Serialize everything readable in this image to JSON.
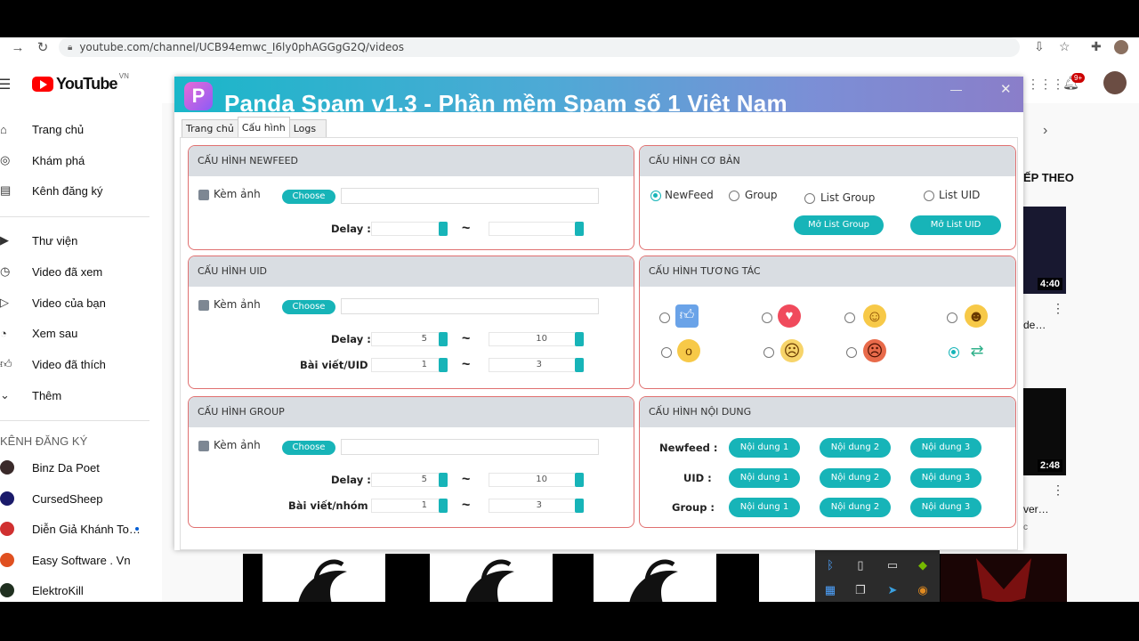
{
  "browser": {
    "url": "youtube.com/channel/UCB94emwc_I6ly0phAGGgG2Q/videos"
  },
  "youtube": {
    "logo_text": "YouTube",
    "region": "VN",
    "notif_badge": "9+",
    "sidebar": [
      {
        "icon": "home-icon",
        "label": "Trang chủ"
      },
      {
        "icon": "compass-icon",
        "label": "Khám phá"
      },
      {
        "icon": "subscriptions-icon",
        "label": "Kênh đăng ký"
      },
      {
        "icon": "library-icon",
        "label": "Thư viện"
      },
      {
        "icon": "history-icon",
        "label": "Video đã xem"
      },
      {
        "icon": "your-videos-icon",
        "label": "Video của bạn"
      },
      {
        "icon": "watch-later-icon",
        "label": "Xem sau"
      },
      {
        "icon": "like-icon",
        "label": "Video đã thích"
      },
      {
        "icon": "chevron-down-icon",
        "label": "Thêm"
      }
    ],
    "subs_heading": "KÊNH ĐĂNG KÝ",
    "subscriptions": [
      "Binz Da Poet",
      "CursedSheep",
      "Diễn Giả Khánh To…",
      "Easy Software . Vn",
      "ElektroKill"
    ],
    "right": {
      "heading": "ẾP THEO",
      "dur1": "4:40",
      "title1": "de…",
      "dur2": "2:48",
      "title2": "ver…",
      "meta2": "c"
    }
  },
  "app": {
    "title": "Panda Spam v1.3 - Phần mềm Spam số 1 Việt Nam",
    "tabs": [
      "Trang chủ",
      "Cấu hình",
      "Logs"
    ],
    "newfeed": {
      "heading": "CẤU HÌNH NEWFEED",
      "attach": "Kèm ảnh",
      "choose": "Choose",
      "delay": "Delay :",
      "tilde": "~"
    },
    "uid": {
      "heading": "CẤU HÌNH UID",
      "attach": "Kèm ảnh",
      "choose": "Choose",
      "delay": "Delay :",
      "delay_from": "5",
      "delay_to": "10",
      "posts": "Bài viết/UID :",
      "posts_from": "1",
      "posts_to": "3",
      "tilde": "~"
    },
    "group": {
      "heading": "CẤU HÌNH GROUP",
      "attach": "Kèm ảnh",
      "choose": "Choose",
      "delay": "Delay :",
      "delay_from": "5",
      "delay_to": "10",
      "posts": "Bài viết/nhóm :",
      "posts_from": "1",
      "posts_to": "3",
      "tilde": "~"
    },
    "basic": {
      "heading": "CẤU HÌNH CƠ BẢN",
      "options": [
        "NewFeed",
        "Group",
        "List Group",
        "List UID"
      ],
      "selected": "NewFeed",
      "open_group": "Mở List Group",
      "open_uid": "Mở List UID"
    },
    "interact": {
      "heading": "CẤU HÌNH TƯƠNG TÁC",
      "reactions": [
        "like",
        "love",
        "care",
        "haha",
        "wow",
        "sad",
        "angry",
        "random"
      ],
      "selected": "random"
    },
    "content": {
      "heading": "CẤU HÌNH NỘI DUNG",
      "rows": [
        {
          "label": "Newfeed :",
          "buttons": [
            "Nội dung 1",
            "Nội dung 2",
            "Nội dung 3"
          ]
        },
        {
          "label": "UID :",
          "buttons": [
            "Nội dung 1",
            "Nội dung 2",
            "Nội dung 3"
          ]
        },
        {
          "label": "Group :",
          "buttons": [
            "Nội dung 1",
            "Nội dung 2",
            "Nội dung 3"
          ]
        }
      ]
    }
  },
  "colors": {
    "accent": "#17b4b8",
    "panel_border": "#e07070",
    "panel_head": "#d9dde2",
    "youtube_red": "#ff0000"
  }
}
